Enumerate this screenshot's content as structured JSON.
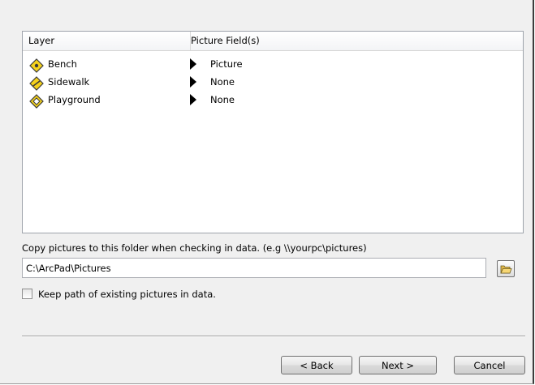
{
  "layers_table": {
    "columns": [
      "Layer",
      "Picture Field(s)"
    ],
    "rows": [
      {
        "layer": "Bench",
        "picture_field": "Picture",
        "icon": "point-layer-icon"
      },
      {
        "layer": "Sidewalk",
        "picture_field": "None",
        "icon": "line-layer-icon"
      },
      {
        "layer": "Playground",
        "picture_field": "None",
        "icon": "polygon-layer-icon"
      }
    ]
  },
  "folder": {
    "label": "Copy pictures to this folder when checking in data. (e.g \\\\yourpc\\pictures)",
    "value": "C:\\ArcPad\\Pictures",
    "browse_icon": "folder-open-icon"
  },
  "keep_path": {
    "label": "Keep path of existing pictures in data.",
    "checked": false
  },
  "buttons": {
    "back": "< Back",
    "next": "Next >",
    "cancel": "Cancel"
  },
  "colors": {
    "layer_icon_fill": "#f5d21c",
    "layer_icon_stroke": "#3a3a3a",
    "dialog_bg": "#f0f0f0"
  }
}
